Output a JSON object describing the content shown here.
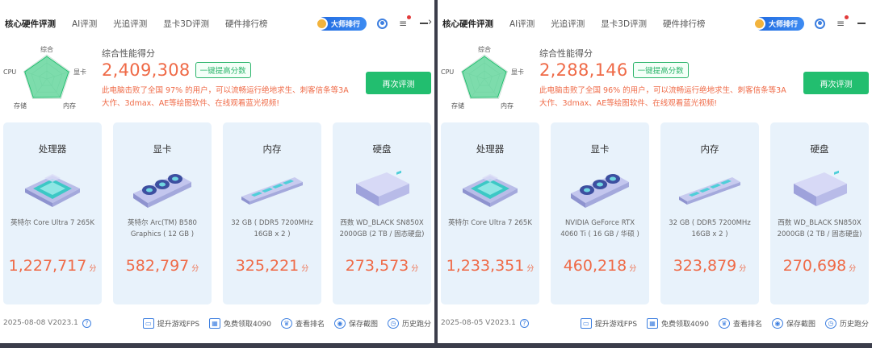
{
  "panels": [
    {
      "tabs": [
        "核心硬件评测",
        "AI评测",
        "光追评测",
        "显卡3D评测",
        "硬件排行榜"
      ],
      "master_label": "大师排行",
      "radar_labels": {
        "top": "综合",
        "left": "CPU",
        "right": "显卡",
        "bottom_left": "存储",
        "bottom_right": "内存"
      },
      "score_title": "综合性能得分",
      "score": "2,409,308",
      "boost_label": "一键提高分数",
      "description": "此电脑击败了全国 97% 的用户，可以流畅运行绝地求生、刺客信条等3A大作、3dmax、AE等绘图软件、在线观看蓝光视频!",
      "retest_label": "再次评测",
      "cards": [
        {
          "title": "处理器",
          "desc": "英特尔 Core Ultra 7 265K",
          "score": "1,227,717",
          "unit": "分",
          "icon": "cpu-chip-icon"
        },
        {
          "title": "显卡",
          "desc": "英特尔 Arc(TM) B580 Graphics ( 12 GB )",
          "score": "582,797",
          "unit": "分",
          "icon": "graphics-card-icon"
        },
        {
          "title": "内存",
          "desc": "32 GB ( DDR5 7200MHz 16GB x 2 )",
          "score": "325,221",
          "unit": "分",
          "icon": "memory-stick-icon"
        },
        {
          "title": "硬盘",
          "desc": "西数 WD_BLACK SN850X 2000GB (2 TB / 固态硬盘)",
          "score": "273,573",
          "unit": "分",
          "icon": "hard-drive-icon"
        }
      ],
      "version": "2025-08-08 V2023.1",
      "actions": [
        "提升游戏FPS",
        "免费领取4090",
        "查看排名",
        "保存截图",
        "历史跑分"
      ]
    },
    {
      "tabs": [
        "核心硬件评测",
        "AI评测",
        "光追评测",
        "显卡3D评测",
        "硬件排行榜"
      ],
      "master_label": "大师排行",
      "radar_labels": {
        "top": "综合",
        "left": "CPU",
        "right": "显卡",
        "bottom_left": "存储",
        "bottom_right": "内存"
      },
      "score_title": "综合性能得分",
      "score": "2,288,146",
      "boost_label": "一键提高分数",
      "description": "此电脑击败了全国 96% 的用户，可以流畅运行绝地求生、刺客信条等3A大作、3dmax、AE等绘图软件、在线观看蓝光视频!",
      "retest_label": "再次评测",
      "cards": [
        {
          "title": "处理器",
          "desc": "英特尔 Core Ultra 7 265K",
          "score": "1,233,351",
          "unit": "分",
          "icon": "cpu-chip-icon"
        },
        {
          "title": "显卡",
          "desc": "NVIDIA GeForce RTX 4060 Ti ( 16 GB / 华硕 )",
          "score": "460,218",
          "unit": "分",
          "icon": "graphics-card-icon"
        },
        {
          "title": "内存",
          "desc": "32 GB ( DDR5 7200MHz 16GB x 2 )",
          "score": "323,879",
          "unit": "分",
          "icon": "memory-stick-icon"
        },
        {
          "title": "硬盘",
          "desc": "西数 WD_BLACK SN850X 2000GB (2 TB / 固态硬盘)",
          "score": "270,698",
          "unit": "分",
          "icon": "hard-drive-icon"
        }
      ],
      "version": "2025-08-05 V2023.1",
      "actions": [
        "提升游戏FPS",
        "免费领取4090",
        "查看排名",
        "保存截图",
        "历史跑分"
      ]
    }
  ],
  "colors": {
    "accent_green": "#22be6f",
    "score_orange": "#ef6a47",
    "card_bg": "#e8f2fb",
    "brand_blue": "#3d7fe0"
  }
}
